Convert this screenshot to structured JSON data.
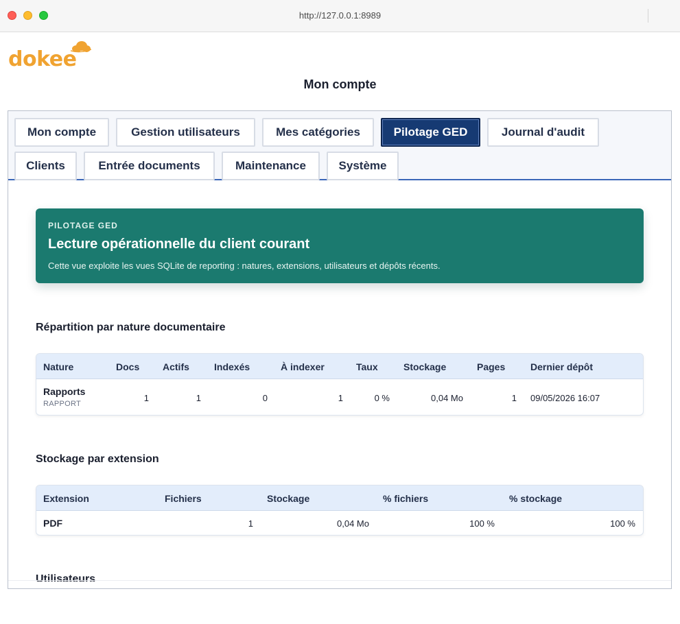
{
  "browser": {
    "url": "http://127.0.0.1:8989"
  },
  "header": {
    "logo_text": "dokee",
    "page_title": "Mon compte"
  },
  "tabs": [
    {
      "label": "Mon compte",
      "active": false
    },
    {
      "label": "Gestion utilisateurs",
      "active": false
    },
    {
      "label": "Mes catégories",
      "active": false
    },
    {
      "label": "Pilotage GED",
      "active": true
    },
    {
      "label": "Journal d'audit",
      "active": false
    },
    {
      "label": "Clients",
      "active": false
    },
    {
      "label": "Entrée documents",
      "active": false
    },
    {
      "label": "Maintenance",
      "active": false
    },
    {
      "label": "Système",
      "active": false
    }
  ],
  "banner": {
    "eyebrow": "PILOTAGE GED",
    "title": "Lecture opérationnelle du client courant",
    "description": "Cette vue exploite les vues SQLite de reporting : natures, extensions, utilisateurs et dépôts récents."
  },
  "natures": {
    "title": "Répartition par nature documentaire",
    "columns": [
      "Nature",
      "Docs",
      "Actifs",
      "Indexés",
      "À indexer",
      "Taux",
      "Stockage",
      "Pages",
      "Dernier dépôt"
    ],
    "rows": [
      {
        "nature": "Rapports",
        "code": "RAPPORT",
        "docs": "1",
        "actifs": "1",
        "indexes": "0",
        "a_indexer": "1",
        "taux": "0 %",
        "stockage": "0,04 Mo",
        "pages": "1",
        "dernier_depot": "09/05/2026 16:07"
      }
    ]
  },
  "extensions": {
    "title": "Stockage par extension",
    "columns": [
      "Extension",
      "Fichiers",
      "Stockage",
      "% fichiers",
      "% stockage"
    ],
    "rows": [
      {
        "extension": "PDF",
        "fichiers": "1",
        "stockage": "0,04 Mo",
        "pct_fichiers": "100 %",
        "pct_stockage": "100 %"
      }
    ]
  },
  "users": {
    "title": "Utilisateurs"
  },
  "colors": {
    "accent": "#163a73",
    "banner": "#1b7a6f",
    "logo": "#f0a331",
    "table_header": "#e3edfb"
  }
}
